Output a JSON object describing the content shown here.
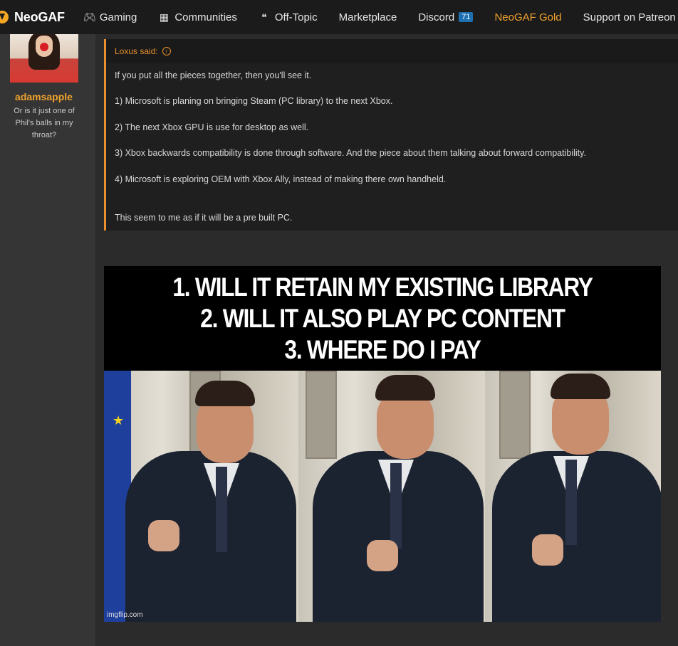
{
  "nav": {
    "logo_text": "NeoGAF",
    "items": [
      {
        "label": "Gaming",
        "icon": "gamepad-icon"
      },
      {
        "label": "Communities",
        "icon": "building-icon"
      },
      {
        "label": "Off-Topic",
        "icon": "chat-bubbles-icon"
      },
      {
        "label": "Marketplace"
      },
      {
        "label": "Discord",
        "badge": "71"
      },
      {
        "label": "NeoGAF Gold",
        "color": "#f0a22d"
      },
      {
        "label": "Support on Patreon"
      }
    ]
  },
  "user": {
    "name": "adamsapple",
    "title": "Or is it just one of Phil's balls in my throat?"
  },
  "quote": {
    "header": "Loxus said:",
    "lines": [
      "If you put all the pieces together, then you'll see it.",
      "1) Microsoft is planing on bringing Steam (PC library) to the next Xbox.",
      "2) The next Xbox GPU is use for desktop as well.",
      "3) Xbox backwards compatibility is done through software. And the piece about them talking about forward compatibility.",
      "4) Microsoft is exploring OEM with Xbox Ally, instead of making there own handheld.",
      "This seem to me as if it will be a pre built PC."
    ]
  },
  "meme": {
    "caption_lines": [
      "1. WILL IT RETAIN MY EXISTING LIBRARY",
      "2. WILL IT ALSO PLAY PC CONTENT",
      "3. WHERE DO I PAY"
    ],
    "watermark": "imgflip.com"
  },
  "colors": {
    "accent": "#f0a22d",
    "quote_border": "#e8912e",
    "badge": "#1f6fb3"
  }
}
